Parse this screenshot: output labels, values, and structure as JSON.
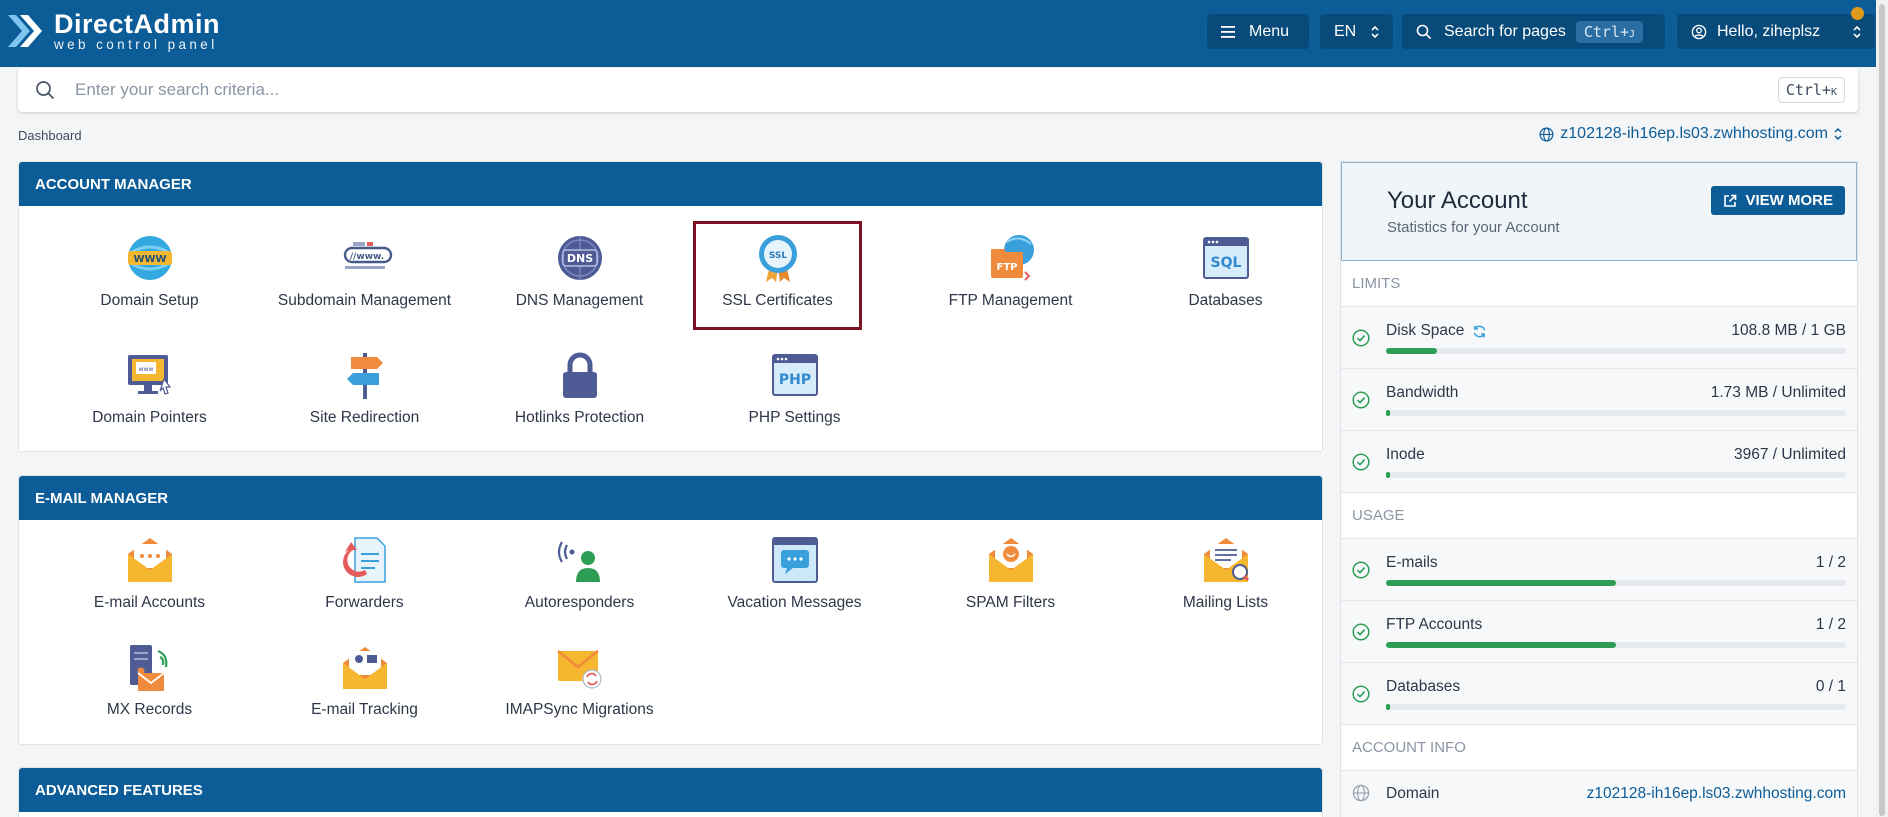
{
  "app": {
    "logo_title": "DirectAdmin",
    "logo_subtitle": "web control panel"
  },
  "topbar": {
    "menu_label": "Menu",
    "language": "EN",
    "search_pages_label": "Search for pages",
    "search_pages_shortcut": "Ctrl+",
    "search_pages_shortcut_key": "J",
    "user_greeting": "Hello, ziheplsz"
  },
  "search": {
    "placeholder": "Enter your search criteria...",
    "shortcut": "Ctrl+",
    "shortcut_key": "K"
  },
  "breadcrumb": "Dashboard",
  "current_domain": "z102128-ih16ep.ls03.zwhhosting.com",
  "account_manager": {
    "title": "ACCOUNT MANAGER",
    "items": [
      {
        "label": "Domain Setup",
        "icon": "globe-www-icon"
      },
      {
        "label": "Subdomain Management",
        "icon": "subdomain-icon"
      },
      {
        "label": "DNS Management",
        "icon": "dns-icon"
      },
      {
        "label": "SSL Certificates",
        "icon": "ssl-certificate-icon"
      },
      {
        "label": "FTP Management",
        "icon": "ftp-folder-icon"
      },
      {
        "label": "Databases",
        "icon": "sql-database-icon"
      },
      {
        "label": "Domain Pointers",
        "icon": "domain-pointer-icon"
      },
      {
        "label": "Site Redirection",
        "icon": "signpost-icon"
      },
      {
        "label": "Hotlinks Protection",
        "icon": "padlock-icon"
      },
      {
        "label": "PHP Settings",
        "icon": "php-icon"
      }
    ]
  },
  "email_manager": {
    "title": "E-MAIL MANAGER",
    "items": [
      {
        "label": "E-mail Accounts",
        "icon": "envelope-icon"
      },
      {
        "label": "Forwarders",
        "icon": "forwarder-icon"
      },
      {
        "label": "Autoresponders",
        "icon": "autoresponder-icon"
      },
      {
        "label": "Vacation Messages",
        "icon": "vacation-message-icon"
      },
      {
        "label": "SPAM Filters",
        "icon": "spam-filter-icon"
      },
      {
        "label": "Mailing Lists",
        "icon": "mailing-list-icon"
      },
      {
        "label": "MX Records",
        "icon": "mx-records-icon"
      },
      {
        "label": "E-mail Tracking",
        "icon": "email-tracking-icon"
      },
      {
        "label": "IMAPSync Migrations",
        "icon": "imapsync-icon"
      }
    ]
  },
  "advanced_features": {
    "title": "ADVANCED FEATURES"
  },
  "your_account": {
    "title": "Your Account",
    "subtitle": "Statistics for your Account",
    "view_more": "VIEW MORE",
    "limits_label": "LIMITS",
    "usage_label": "USAGE",
    "account_info_label": "ACCOUNT INFO",
    "limits": [
      {
        "name": "Disk Space",
        "value": "108.8 MB / 1 GB",
        "fraction": 0.11
      },
      {
        "name": "Bandwidth",
        "value": "1.73 MB / Unlimited",
        "fraction": 0.008
      },
      {
        "name": "Inode",
        "value": "3967 / Unlimited",
        "fraction": 0.008
      }
    ],
    "usage": [
      {
        "name": "E-mails",
        "value": "1 / 2",
        "fraction": 0.5
      },
      {
        "name": "FTP Accounts",
        "value": "1 / 2",
        "fraction": 0.5
      },
      {
        "name": "Databases",
        "value": "0 / 1",
        "fraction": 0.008
      }
    ],
    "info": [
      {
        "name": "Domain",
        "value": "z102128-ih16ep.ls03.zwhhosting.com"
      }
    ]
  },
  "colors": {
    "brand": "#0b5c97",
    "progress": "#2e9e56",
    "selected_outline": "#7d1223"
  }
}
